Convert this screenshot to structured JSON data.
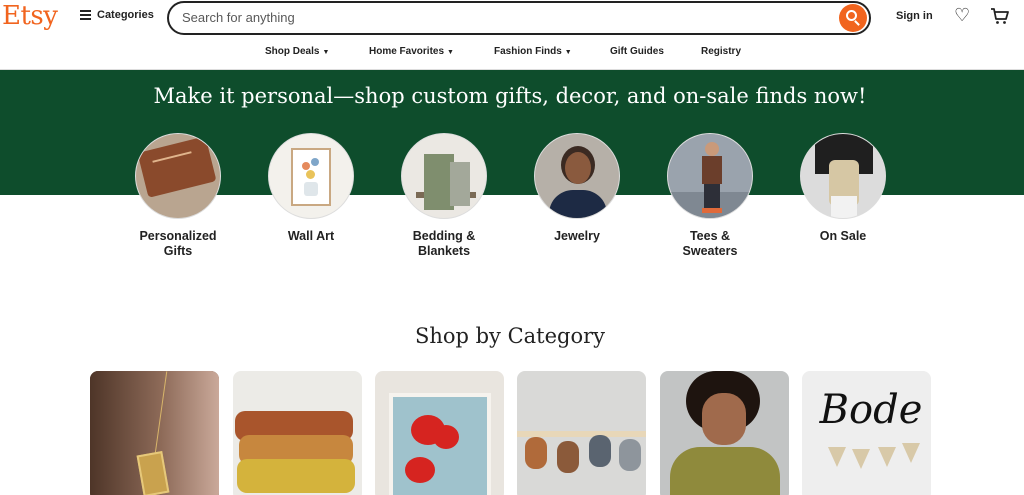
{
  "header": {
    "logo": "Etsy",
    "categories_label": "Categories",
    "search_placeholder": "Search for anything",
    "signin_label": "Sign in",
    "heart_glyph": "♡"
  },
  "nav": {
    "items": [
      {
        "label": "Shop Deals",
        "caret": "▼"
      },
      {
        "label": "Home Favorites",
        "caret": "▼"
      },
      {
        "label": "Fashion Finds",
        "caret": "▼"
      },
      {
        "label": "Gift Guides"
      },
      {
        "label": "Registry"
      }
    ]
  },
  "banner": {
    "title": "Make it personal—shop custom gifts, decor, and on-sale finds now!",
    "color": "#0e4d2c"
  },
  "circles": [
    {
      "label_line1": "Personalized",
      "label_line2": "Gifts"
    },
    {
      "label_line1": "Wall Art"
    },
    {
      "label_line1": "Bedding &",
      "label_line2": "Blankets"
    },
    {
      "label_line1": "Jewelry"
    },
    {
      "label_line1": "Tees &",
      "label_line2": "Sweaters"
    },
    {
      "label_line1": "On Sale"
    }
  ],
  "shop_by_category": {
    "title": "Shop by Category",
    "card_text": "Bode"
  },
  "colors": {
    "brand": "#f1641e"
  }
}
